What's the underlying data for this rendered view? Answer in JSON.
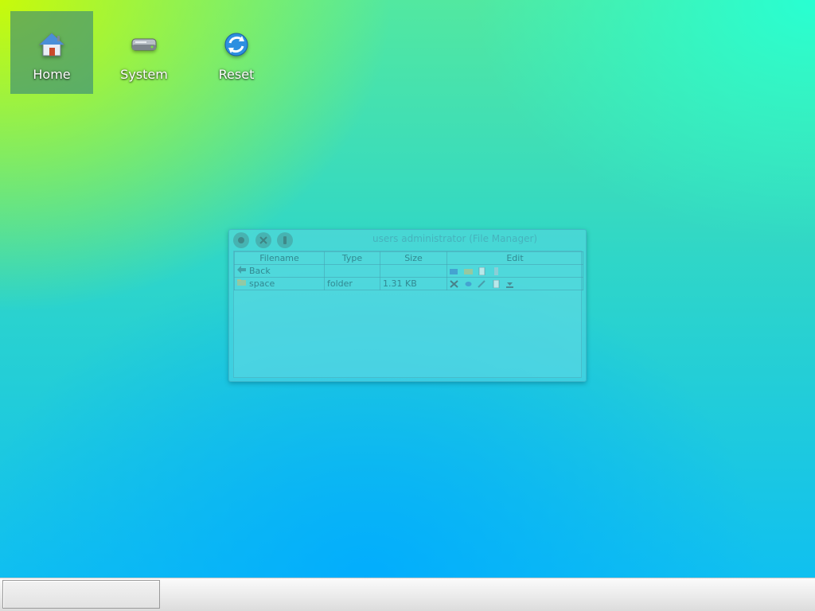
{
  "desktop": {
    "icons": [
      {
        "label": "Home",
        "icon": "home-icon",
        "selected": true
      },
      {
        "label": "System",
        "icon": "drive-icon",
        "selected": false
      },
      {
        "label": "Reset",
        "icon": "refresh-icon",
        "selected": false
      }
    ]
  },
  "window": {
    "title": "users administrator (File Manager)",
    "buttons": [
      "close-icon",
      "maximize-icon",
      "minimize-icon"
    ],
    "columns": [
      "Filename",
      "Type",
      "Size",
      "Edit"
    ],
    "rows": [
      {
        "name": "Back",
        "type": "",
        "size": "",
        "icon": "back-arrow-icon"
      },
      {
        "name": "space",
        "type": "folder",
        "size": "1.31 KB",
        "icon": "folder-icon"
      }
    ]
  },
  "taskbar": {
    "task_label": ""
  },
  "colors": {
    "selection": "#3f8f96",
    "taskbar": "#ececec"
  }
}
